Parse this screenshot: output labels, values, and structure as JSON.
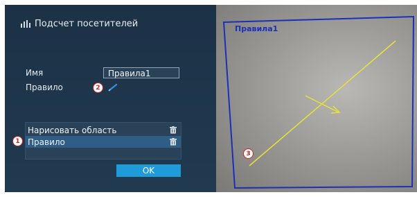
{
  "dialog": {
    "title": "Подсчет посетителей",
    "name_label": "Имя",
    "name_value": "Правила1",
    "rule_label": "Правило"
  },
  "list": {
    "items": [
      {
        "label": "Нарисовать область",
        "selected": false
      },
      {
        "label": "Правило",
        "selected": true
      }
    ]
  },
  "buttons": {
    "ok_label": "OK"
  },
  "callouts": [
    "1",
    "2",
    "3"
  ],
  "preview": {
    "area_label": "Правила1"
  },
  "colors": {
    "panel_bg": "#1f3448",
    "accent": "#1e9bd8",
    "selection": "#2f5d86",
    "area_line": "#1d2fb8",
    "rule_line": "#e6e23a",
    "callout": "#d32020"
  },
  "icons": {
    "header": "bar-chart-icon",
    "rule_edit": "pencil-icon",
    "row_delete": "trash-icon"
  }
}
